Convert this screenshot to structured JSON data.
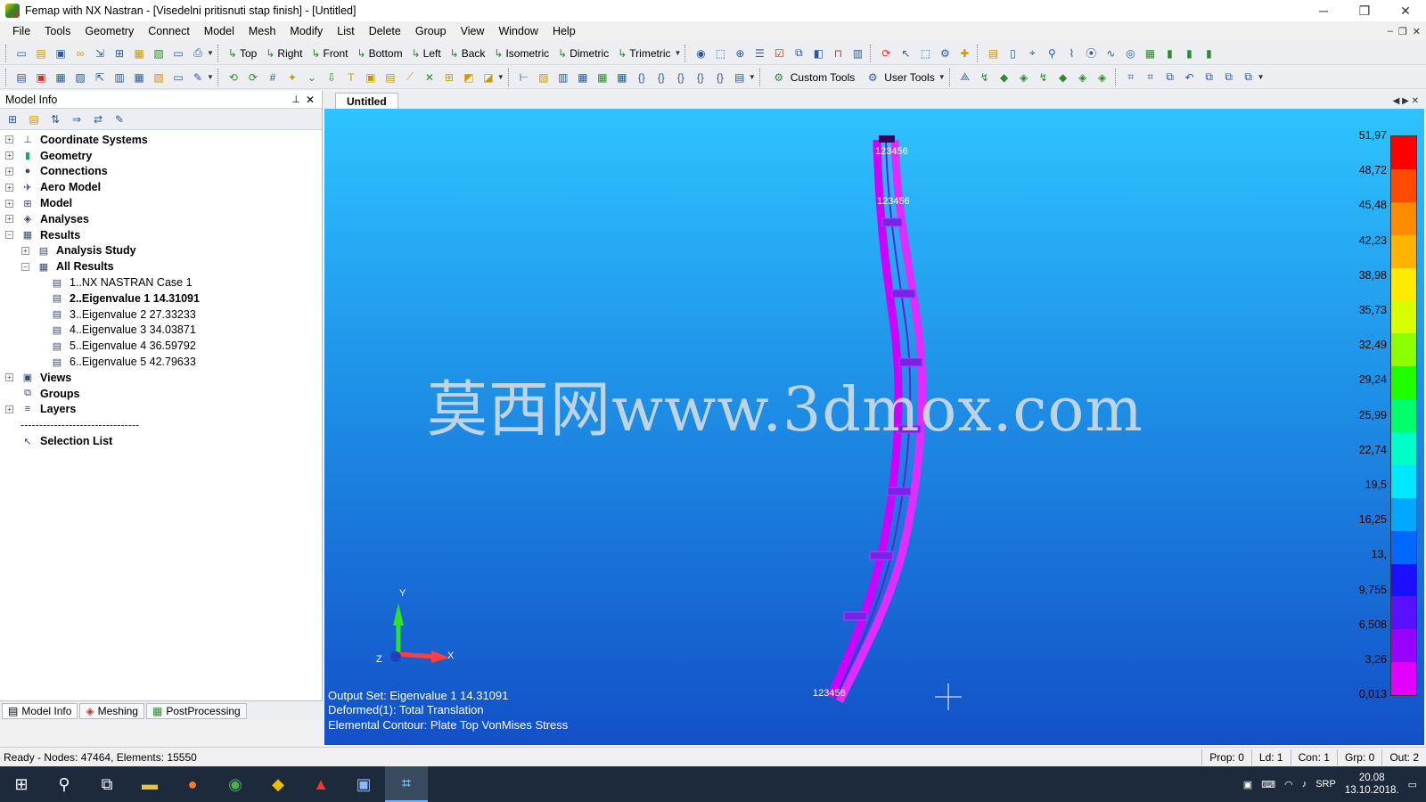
{
  "window": {
    "title": "Femap with NX Nastran - [Visedelni pritisnuti stap finish] - [Untitled]",
    "controls": [
      "─",
      "❐",
      "✕"
    ]
  },
  "menu": [
    "File",
    "Tools",
    "Geometry",
    "Connect",
    "Model",
    "Mesh",
    "Modify",
    "List",
    "Delete",
    "Group",
    "View",
    "Window",
    "Help"
  ],
  "view_buttons": [
    "Top",
    "Right",
    "Front",
    "Bottom",
    "Left",
    "Back",
    "Isometric",
    "Dimetric",
    "Trimetric"
  ],
  "tool_buttons": [
    "Custom Tools",
    "User Tools"
  ],
  "panel": {
    "title": "Model Info",
    "tree": [
      {
        "label": "Coordinate Systems",
        "level": 0,
        "exp": "+",
        "icon": "coordinate-icon"
      },
      {
        "label": "Geometry",
        "level": 0,
        "exp": "+",
        "icon": "geometry-icon"
      },
      {
        "label": "Connections",
        "level": 0,
        "exp": "+",
        "icon": "connections-icon"
      },
      {
        "label": "Aero Model",
        "level": 0,
        "exp": "+",
        "icon": "aero-icon"
      },
      {
        "label": "Model",
        "level": 0,
        "exp": "+",
        "icon": "model-icon"
      },
      {
        "label": "Analyses",
        "level": 0,
        "exp": "+",
        "icon": "analyses-icon"
      },
      {
        "label": "Results",
        "level": 0,
        "exp": "−",
        "icon": "results-icon"
      },
      {
        "label": "Analysis Study",
        "level": 1,
        "exp": "+",
        "icon": "study-icon"
      },
      {
        "label": "All Results",
        "level": 1,
        "exp": "−",
        "icon": "results-icon"
      },
      {
        "label": "1..NX NASTRAN Case 1",
        "level": 2,
        "exp": "",
        "icon": "output-set-icon"
      },
      {
        "label": "2..Eigenvalue 1 14.31091",
        "level": 2,
        "exp": "",
        "icon": "output-set-icon",
        "active": true
      },
      {
        "label": "3..Eigenvalue 2 27.33233",
        "level": 2,
        "exp": "",
        "icon": "output-set-icon"
      },
      {
        "label": "4..Eigenvalue 3 34.03871",
        "level": 2,
        "exp": "",
        "icon": "output-set-icon"
      },
      {
        "label": "5..Eigenvalue 4 36.59792",
        "level": 2,
        "exp": "",
        "icon": "output-set-icon"
      },
      {
        "label": "6..Eigenvalue 5 42.79633",
        "level": 2,
        "exp": "",
        "icon": "output-set-icon"
      },
      {
        "label": "Views",
        "level": 0,
        "exp": "+",
        "icon": "views-icon"
      },
      {
        "label": "Groups",
        "level": 0,
        "exp": "",
        "icon": "groups-icon"
      },
      {
        "label": "Layers",
        "level": 0,
        "exp": "+",
        "icon": "layers-icon"
      },
      {
        "label": "--------------------------------",
        "level": 0,
        "exp": "",
        "icon": "",
        "sep": true
      },
      {
        "label": "Selection List",
        "level": 0,
        "exp": "",
        "icon": "selection-icon"
      }
    ],
    "tabs": [
      "Model Info",
      "Meshing",
      "PostProcessing"
    ]
  },
  "document": {
    "tab": "Untitled",
    "watermark": "莫西网www.3dmox.com",
    "info": [
      "Output Set: Eigenvalue 1 14.31091",
      "Deformed(1): Total Translation",
      "Elemental Contour: Plate Top VonMises Stress"
    ],
    "node_labels": [
      "123456",
      "123456",
      "123456"
    ],
    "axes": {
      "x": "X",
      "y": "Y",
      "z": "Z"
    }
  },
  "legend": {
    "values": [
      "51,97",
      "48,72",
      "45,48",
      "42,23",
      "38,98",
      "35,73",
      "32,49",
      "29,24",
      "25,99",
      "22,74",
      "19,5",
      "16,25",
      "13,",
      "9,755",
      "6,508",
      "3,26",
      "0,013"
    ],
    "colors": [
      "#ff0000",
      "#ff4a00",
      "#ff8c00",
      "#ffb400",
      "#ffea00",
      "#d8ff00",
      "#8cff00",
      "#1eff00",
      "#00ff6a",
      "#00ffc8",
      "#00e8ff",
      "#00a8ff",
      "#0068ff",
      "#1a10ff",
      "#5a10ff",
      "#9a00ff",
      "#e200ff"
    ]
  },
  "status": {
    "left": "Ready - Nodes: 47464,  Elements: 15550",
    "right": [
      "Prop: 0",
      "Ld: 1",
      "Con: 1",
      "Grp: 0",
      "Out: 2"
    ]
  },
  "taskbar": {
    "time": "20.08",
    "date": "13.10.2018.",
    "lang": "SRP"
  }
}
